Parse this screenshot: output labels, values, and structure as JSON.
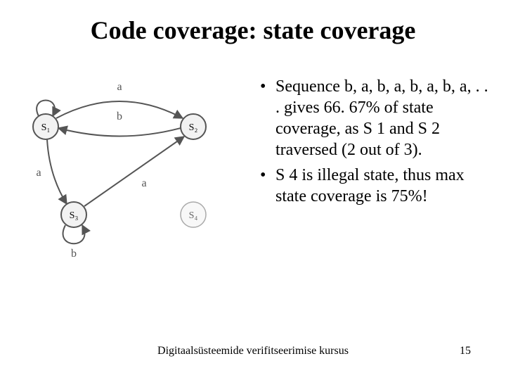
{
  "title": "Code coverage: state coverage",
  "bullets": [
    "Sequence b, a, b, a, b, a, b, a, . . . gives 66. 67% of state coverage, as S 1 and S 2 traversed (2 out of 3).",
    "S 4 is illegal state, thus max state coverage is 75%!"
  ],
  "footer": {
    "text": "Digitaalsüsteemide verifitseerimise kursus",
    "page": "15"
  },
  "diagram": {
    "nodes": {
      "s1": "S₁",
      "s2": "S₂",
      "s3": "S₃",
      "s4": "S₄"
    },
    "edge_labels": {
      "s1_self_a": "a",
      "s1_s2_b": "b",
      "s1_s3_a": "a",
      "s3_s2_a": "a",
      "s3_self_b": "b"
    }
  }
}
